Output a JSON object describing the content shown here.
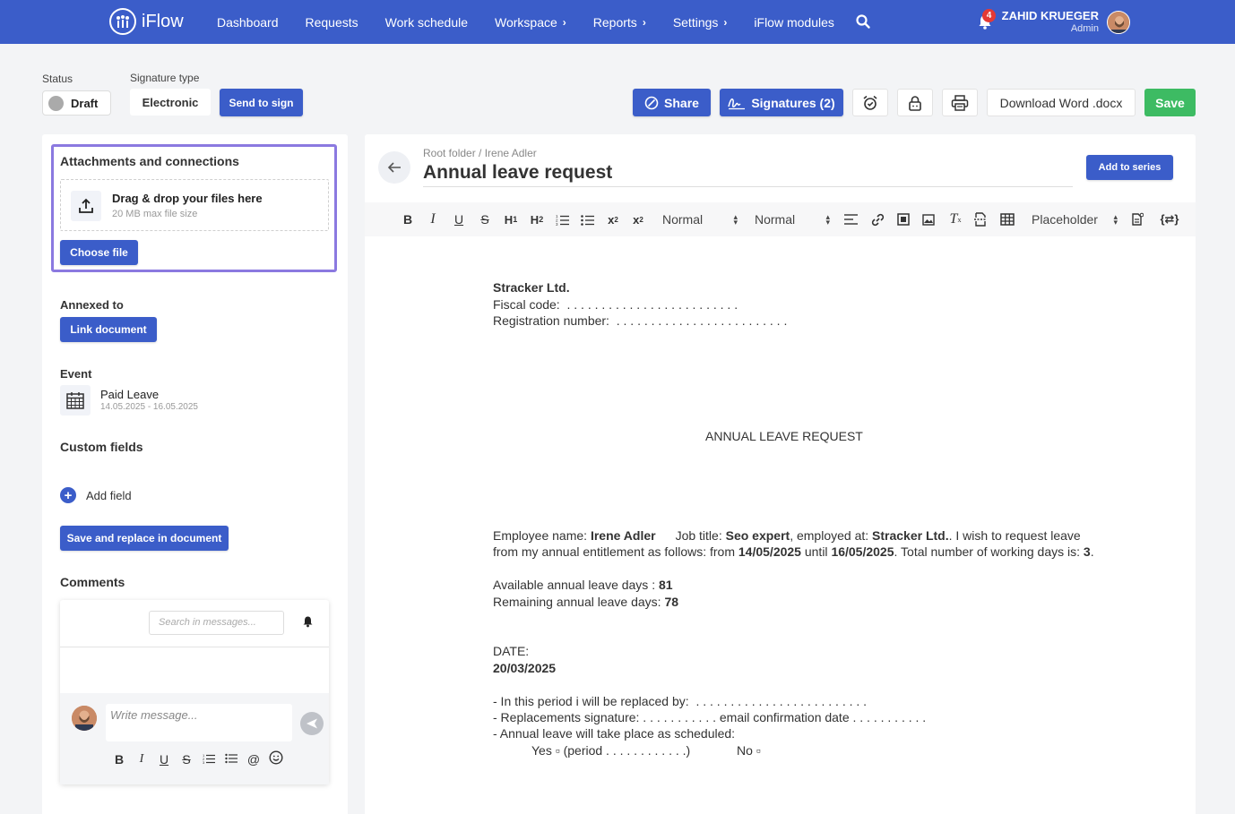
{
  "nav": {
    "brand": "iFlow",
    "items": [
      {
        "label": "Dashboard",
        "chevron": false
      },
      {
        "label": "Requests",
        "chevron": false
      },
      {
        "label": "Work schedule",
        "chevron": false
      },
      {
        "label": "Workspace",
        "chevron": true
      },
      {
        "label": "Reports",
        "chevron": true
      },
      {
        "label": "Settings",
        "chevron": true
      },
      {
        "label": "iFlow modules",
        "chevron": false
      }
    ],
    "notifications": "4",
    "user_name": "ZAHID KRUEGER",
    "user_role": "Admin"
  },
  "controls": {
    "status_label": "Status",
    "status_value": "Draft",
    "signature_type_label": "Signature type",
    "signature_type_value": "Electronic",
    "send_to_sign": "Send to sign",
    "share": "Share",
    "signatures": "Signatures (2)",
    "download_word": "Download Word .docx",
    "save": "Save"
  },
  "left": {
    "attachments_title": "Attachments and connections",
    "drop_title": "Drag & drop your files here",
    "drop_sub": "20 MB max file size",
    "choose_file": "Choose file",
    "annexed_title": "Annexed to",
    "link_document": "Link document",
    "event_title": "Event",
    "event_name": "Paid Leave",
    "event_dates": "14.05.2025 - 16.05.2025",
    "custom_fields_title": "Custom fields",
    "add_field": "Add field",
    "save_replace": "Save and replace in document",
    "comments_title": "Comments",
    "search_placeholder": "Search in messages...",
    "write_placeholder": "Write message..."
  },
  "document": {
    "breadcrumb": "Root folder / Irene Adler",
    "title": "Annual leave request",
    "add_to_series": "Add to series",
    "toolbar": {
      "font_size": "Normal",
      "header": "Normal",
      "placeholder": "Placeholder"
    },
    "body": {
      "company": "Stracker Ltd.",
      "fiscal_label": "Fiscal code:",
      "dots_long": ". . . . . . . . . . . . . . . . . . . . . . . . .",
      "reg_label": "Registration number:",
      "heading": "ANNUAL LEAVE REQUEST",
      "emp_label": "Employee name: ",
      "emp_name": "Irene Adler",
      "job_label": "Job title: ",
      "job_title": "Seo expert",
      "employed_label": ", employed at: ",
      "employer": "Stracker Ltd.",
      "request_tail": ". I wish to request leave",
      "line2_start": "from my annual entitlement as follows: from ",
      "date_from": "14/05/2025",
      "until": "  until ",
      "date_until": "16/05/2025",
      "days_label": ". Total number of working days is: ",
      "days": "3",
      "period": ".",
      "available_label": "Available annual leave days : ",
      "available": "81",
      "remaining_label": "Remaining annual leave days: ",
      "remaining": "78",
      "date_label": "DATE:",
      "date_value": "20/03/2025",
      "replaced_by": "- In this period i will be replaced by:",
      "replacements_sig": "- Replacements signature: . . . . . . . . . . . email confirmation date . . . . . . . . . . .",
      "scheduled": "- Annual leave will take place as scheduled:",
      "yes_line": "Yes ▫ (period . . . . . . . . . . . .)",
      "no_line": "No ▫"
    }
  }
}
